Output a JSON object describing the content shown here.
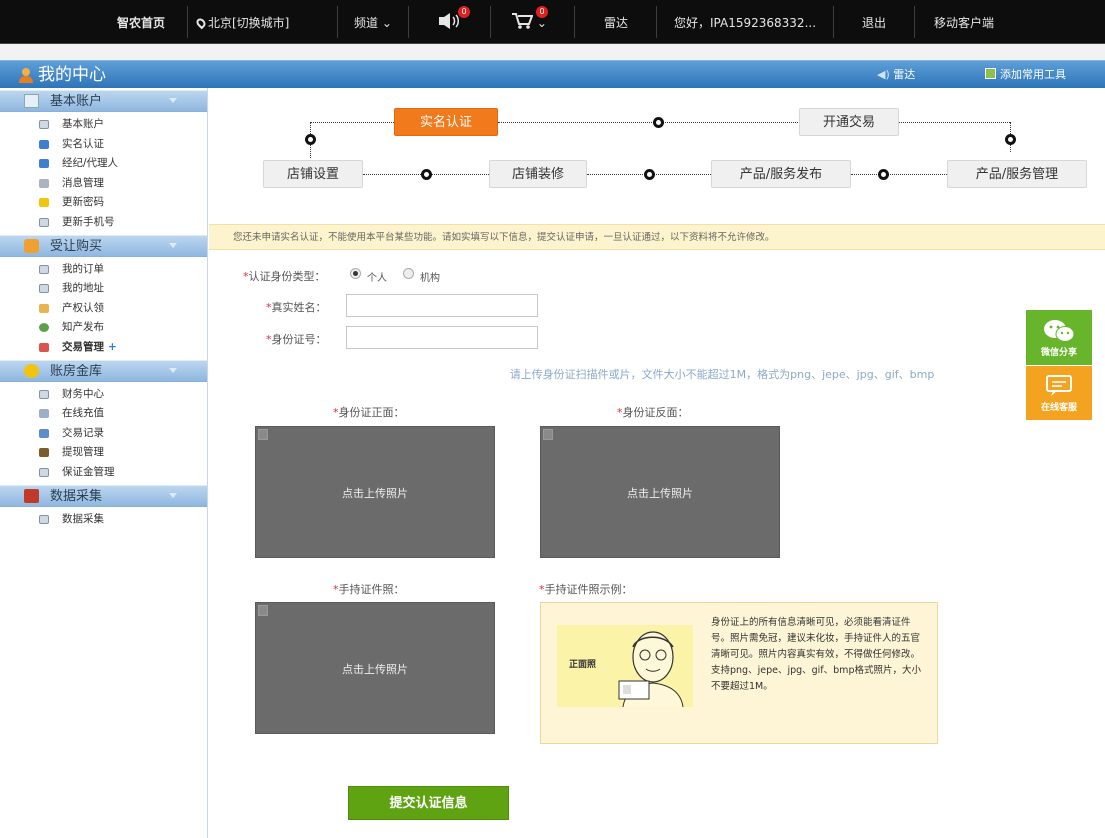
{
  "topnav": {
    "home": "智农首页",
    "location": "北京[切换城市]",
    "channel": "频道",
    "speaker_badge": "0",
    "cart_badge": "0",
    "radar": "雷达",
    "greeting": "您好，IPA1592368332...",
    "logout": "退出",
    "mobile": "移动客户端"
  },
  "header": {
    "title": "我的中心",
    "radar": "雷达",
    "add_tool": "添加常用工具"
  },
  "sidebar": {
    "groups": [
      {
        "label": "基本账户",
        "items": [
          "基本账户",
          "实名认证",
          "经纪/代理人",
          "消息管理",
          "更新密码",
          "更新手机号"
        ]
      },
      {
        "label": "受让购买",
        "items": [
          "我的订单",
          "我的地址",
          "产权认领",
          "知产发布",
          "交易管理"
        ]
      },
      {
        "label": "账房金库",
        "items": [
          "财务中心",
          "在线充值",
          "交易记录",
          "提现管理",
          "保证金管理"
        ]
      },
      {
        "label": "数据采集",
        "items": [
          "数据采集"
        ]
      }
    ],
    "plus": "+"
  },
  "steps": {
    "realname": "实名认证",
    "trade": "开通交易",
    "shop_setup": "店铺设置",
    "shop_decor": "店铺装修",
    "product_publish": "产品/服务发布",
    "product_manage": "产品/服务管理"
  },
  "notice": "您还未申请实名认证，不能使用本平台某些功能。请如实填写以下信息，提交认证申请，一旦认证通过，以下资料将不允许修改。",
  "form": {
    "required_mark": "*",
    "id_type_label": "认证身份类型：",
    "id_type_options": [
      "个人",
      "机构"
    ],
    "id_type_selected": "个人",
    "name_label": "真实姓名：",
    "name_value": "",
    "idno_label": "身份证号：",
    "idno_value": "",
    "upload_hint": "请上传身份证扫描件或片，文件大小不能超过1M，格式为png、jepe、jpg、gif、bmp",
    "front_label": "身份证正面：",
    "back_label": "身份证反面：",
    "hold_label": "手持证件照：",
    "example_label": "手持证件照示例：",
    "upload_text": "点击上传照片",
    "example_pic_text": "正面照",
    "example_desc": "身份证上的所有信息清晰可见，必须能看清证件号。照片需免冠，建议未化妆，手持证件人的五官清晰可见。照片内容真实有效，不得做任何修改。支持png、jepe、jpg、gif、bmp格式照片，大小不要超过1M。",
    "submit": "提交认证信息"
  },
  "float_tools": {
    "wechat": "微信分享",
    "service": "在线客服"
  },
  "colors": {
    "accent_orange": "#f07a1c",
    "submit_green": "#5fa312",
    "header_blue": "#2e74b8"
  }
}
